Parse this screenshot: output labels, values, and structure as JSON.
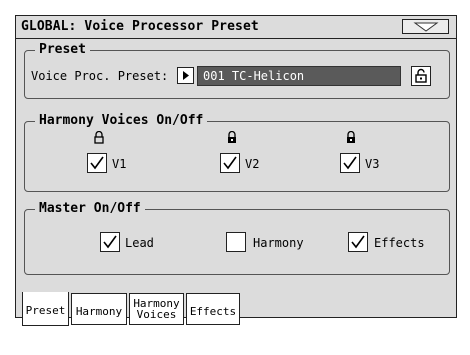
{
  "window": {
    "title": "GLOBAL: Voice Processor Preset"
  },
  "preset_group": {
    "label": "Preset",
    "field_label": "Voice Proc. Preset:",
    "value": "001 TC-Helicon"
  },
  "harmony_group": {
    "label": "Harmony Voices On/Off",
    "voices": [
      {
        "label": "V1",
        "checked": true
      },
      {
        "label": "V2",
        "checked": true
      },
      {
        "label": "V3",
        "checked": true
      }
    ]
  },
  "master_group": {
    "label": "Master On/Off",
    "items": [
      {
        "label": "Lead",
        "checked": true
      },
      {
        "label": "Harmony",
        "checked": false
      },
      {
        "label": "Effects",
        "checked": true
      }
    ]
  },
  "tabs": [
    {
      "line1": "Preset",
      "line2": "",
      "active": true
    },
    {
      "line1": "Harmony",
      "line2": "",
      "active": false
    },
    {
      "line1": "Harmony",
      "line2": "Voices",
      "active": false
    },
    {
      "line1": "Effects",
      "line2": "",
      "active": false
    }
  ]
}
